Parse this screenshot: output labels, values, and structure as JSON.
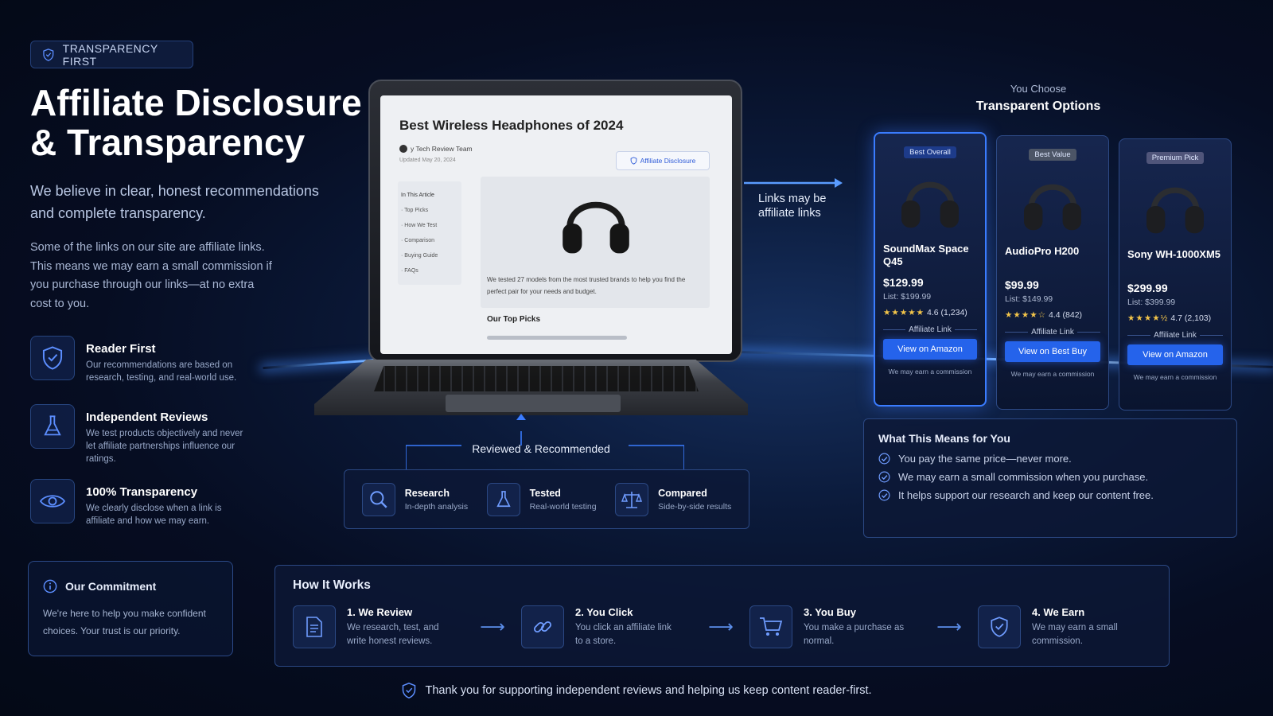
{
  "badge": {
    "label": "TRANSPARENCY FIRST"
  },
  "title": {
    "line1": "Affiliate Disclosure",
    "line2": "& Transparency"
  },
  "subtitle": "We believe in clear, honest recommendations and complete transparency.",
  "intro": "Some of the links on our site are affiliate links. This means we may earn a small commission if you purchase through our links—at no extra cost to you.",
  "features": [
    {
      "title": "Reader First",
      "desc": "Our recommendations are based on research, testing, and real-world use.",
      "icon": "shield-check-icon"
    },
    {
      "title": "Independent Reviews",
      "desc": "We test products objectively and never let affiliate partnerships influence our ratings.",
      "icon": "flask-icon"
    },
    {
      "title": "100% Transparency",
      "desc": "We clearly disclose when a link is affiliate and how we may earn.",
      "icon": "eye-icon"
    }
  ],
  "commitment": {
    "title": "Our Commitment",
    "text": "We're here to help you make confident choices. Your trust is our priority."
  },
  "laptop": {
    "article_title": "Best Wireless Headphones of 2024",
    "byline": "y Tech Review Team",
    "updated": "Updated May 20, 2024",
    "disclosure_button": "Affiliate Disclosure",
    "toc_title": "In This Article",
    "toc": [
      "· Top Picks",
      "· How We Test",
      "· Comparison",
      "· Buying Guide",
      "· FAQs"
    ],
    "body_text": "We tested 27 models from the most trusted brands to help you find the perfect pair for your needs and budget.",
    "section": "Our Top Picks"
  },
  "links_note": "Links may be affiliate links",
  "choose": {
    "kicker": "You Choose",
    "title": "Transparent Options"
  },
  "products": [
    {
      "tag": "Best Overall",
      "name": "SoundMax Space Q45",
      "price": "$129.99",
      "list": "List: $199.99",
      "stars": "★★★★★",
      "rating": "4.6 (1,234)",
      "affiliate": "Affiliate Link",
      "button": "View on Amazon",
      "note": "We may earn a commission"
    },
    {
      "tag": "Best Value",
      "name": "AudioPro H200",
      "price": "$99.99",
      "list": "List: $149.99",
      "stars": "★★★★☆",
      "rating": "4.4 (842)",
      "affiliate": "Affiliate Link",
      "button": "View on Best Buy",
      "note": "We may earn a commission"
    },
    {
      "tag": "Premium Pick",
      "name": "Sony WH-1000XM5",
      "price": "$299.99",
      "list": "List: $399.99",
      "stars": "★★★★½",
      "rating": "4.7 (2,103)",
      "affiliate": "Affiliate Link",
      "button": "View on Amazon",
      "note": "We may earn a commission"
    }
  ],
  "means": {
    "title": "What This Means for You",
    "items": [
      "You pay the same price—never more.",
      "We may earn a small commission when you purchase.",
      "It helps support our research and keep our content free."
    ]
  },
  "reviewed": {
    "label": "Reviewed & Recommended",
    "items": [
      {
        "title": "Research",
        "desc": "In-depth analysis",
        "icon": "magnifier-icon"
      },
      {
        "title": "Tested",
        "desc": "Real-world testing",
        "icon": "flask-icon"
      },
      {
        "title": "Compared",
        "desc": "Side-by-side results",
        "icon": "scales-icon"
      }
    ]
  },
  "how": {
    "title": "How It Works",
    "steps": [
      {
        "title": "1. We Review",
        "desc": "We research, test, and write honest reviews.",
        "icon": "document-icon"
      },
      {
        "title": "2. You Click",
        "desc": "You click an affiliate link to a store.",
        "icon": "link-icon"
      },
      {
        "title": "3. You Buy",
        "desc": "You make a purchase as normal.",
        "icon": "cart-icon"
      },
      {
        "title": "4. We Earn",
        "desc": "We may earn a small commission.",
        "icon": "shield-check-icon"
      }
    ]
  },
  "thanks": "Thank you for supporting independent reviews and helping us keep content reader-first.",
  "colors": {
    "accent": "#2563eb",
    "background": "#060d22",
    "star": "#f3c54a"
  }
}
